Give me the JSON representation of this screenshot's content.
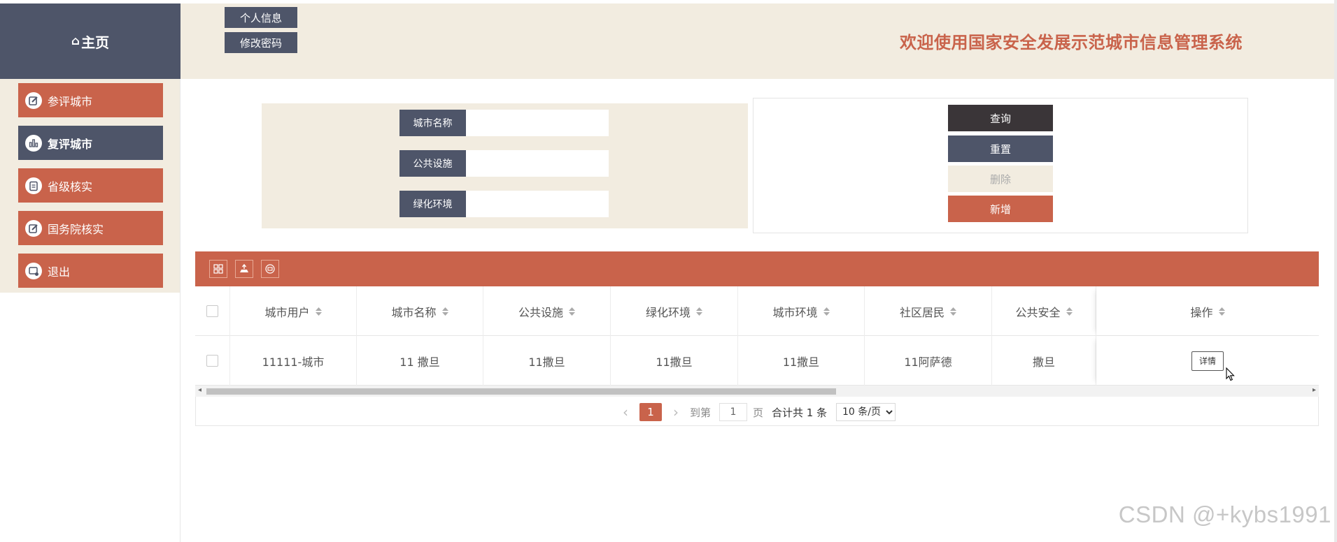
{
  "logo": {
    "home_glyph": "⌂",
    "title": "主页"
  },
  "header": {
    "user_buttons": [
      "个人信息",
      "修改密码"
    ],
    "site_title": "欢迎使用国家安全发展示范城市信息管理系统"
  },
  "sidebar": {
    "items": [
      {
        "label": "参评城市",
        "icon": "edit-icon",
        "active": false
      },
      {
        "label": "复评城市",
        "icon": "bar-chart-icon",
        "active": true
      },
      {
        "label": "省级核实",
        "icon": "clipboard-icon",
        "active": false
      },
      {
        "label": "国务院核实",
        "icon": "edit-icon",
        "active": false
      },
      {
        "label": "退出",
        "icon": "logout-icon",
        "active": false
      }
    ]
  },
  "search": {
    "fields": [
      {
        "label": "城市名称",
        "value": ""
      },
      {
        "label": "公共设施",
        "value": ""
      },
      {
        "label": "绿化环境",
        "value": ""
      }
    ]
  },
  "actions": {
    "query": "查询",
    "reset": "重置",
    "delete": "删除",
    "add": "新增"
  },
  "toolbar": {
    "icons": [
      "columns-icon",
      "export-icon",
      "print-icon"
    ]
  },
  "table": {
    "columns": [
      "城市用户",
      "城市名称",
      "公共设施",
      "绿化环境",
      "城市环境",
      "社区居民",
      "公共安全",
      "操作"
    ],
    "rows": [
      {
        "cells": [
          "11111-城市",
          "11 撒旦",
          "11撒旦",
          "11撒旦",
          "11撒旦",
          "11阿萨德",
          "撒旦"
        ],
        "action": "详情"
      }
    ]
  },
  "pagination": {
    "prev": "‹",
    "next": "›",
    "current_page": "1",
    "goto_prefix": "到第",
    "goto_value": "1",
    "goto_suffix": "页",
    "total_text": "合计共 1 条",
    "page_size": "10 条/页"
  },
  "watermark": "CSDN @+kybs1991",
  "colors": {
    "accent": "#c9634b",
    "dark": "#4e5569",
    "cream": "#f2ece0",
    "query_button": "#3a3538"
  }
}
